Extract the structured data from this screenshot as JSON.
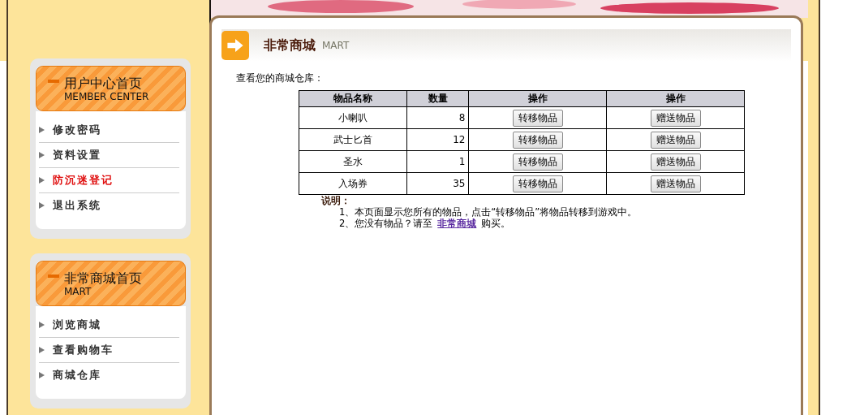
{
  "sidebar": [
    {
      "title": "用户中心首页",
      "subtitle": "MEMBER CENTER",
      "items": [
        {
          "label": "修改密码",
          "highlighted": false
        },
        {
          "label": "资料设置",
          "highlighted": false
        },
        {
          "label": "防沉迷登记",
          "highlighted": true
        },
        {
          "label": "退出系统",
          "highlighted": false
        }
      ]
    },
    {
      "title": "非常商城首页",
      "subtitle": "MART",
      "items": [
        {
          "label": "浏览商城",
          "highlighted": false
        },
        {
          "label": "查看购物车",
          "highlighted": false
        },
        {
          "label": "商城仓库",
          "highlighted": false
        }
      ]
    }
  ],
  "panel": {
    "title": "非常商城",
    "subtitle": "MART",
    "intro": "查看您的商城仓库：",
    "table": {
      "columns": [
        "物品名称",
        "数量",
        "操作",
        "操作"
      ],
      "rows": [
        {
          "name": "小喇叭",
          "quantity": "8",
          "actions": [
            "转移物品",
            "赠送物品"
          ]
        },
        {
          "name": "武士匕首",
          "quantity": "12",
          "actions": [
            "转移物品",
            "赠送物品"
          ]
        },
        {
          "name": "圣水",
          "quantity": "1",
          "actions": [
            "转移物品",
            "赠送物品"
          ]
        },
        {
          "name": "入场券",
          "quantity": "35",
          "actions": [
            "转移物品",
            "赠送物品"
          ]
        }
      ]
    },
    "notes": {
      "heading": "说明：",
      "lines": [
        {
          "text": "1、本页面显示您所有的物品，点击“转移物品”将物品转移到游戏中。"
        },
        {
          "text": "2、您没有物品？请至",
          "link": "非常商城",
          "after": "购买。"
        }
      ]
    }
  }
}
